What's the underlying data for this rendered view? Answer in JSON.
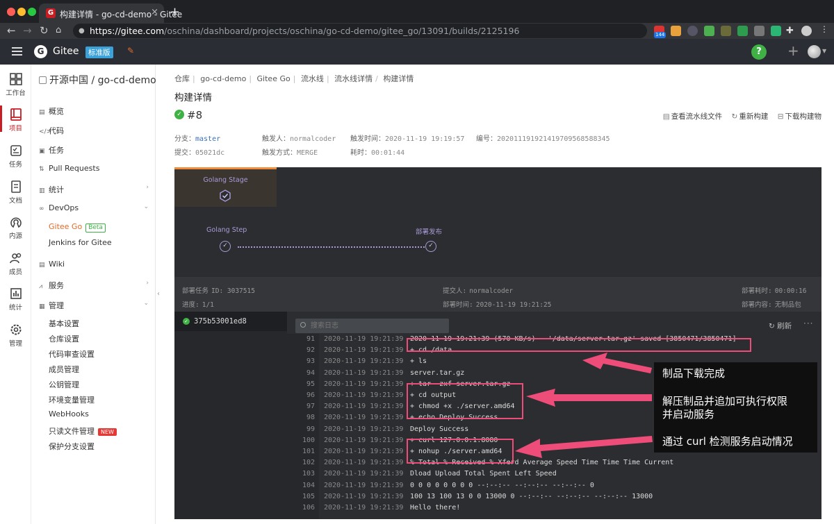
{
  "browser": {
    "tab_title": "构建详情 - go-cd-demo - Gitee",
    "tab_favicon": "G",
    "url_host": "https://gitee.com",
    "url_path": "/oschina/dashboard/projects/oschina/go-cd-demo/gitee_go/13091/builds/2125196",
    "ext_badge": "144"
  },
  "appbar": {
    "brand": "Gitee",
    "edition": "标准版",
    "help": "?"
  },
  "rail": [
    {
      "icon": "dashboard-icon",
      "label": "工作台"
    },
    {
      "icon": "book-icon",
      "label": "项目"
    },
    {
      "icon": "tasks-icon",
      "label": "任务"
    },
    {
      "icon": "document-icon",
      "label": "文档"
    },
    {
      "icon": "opensource-icon",
      "label": "内源"
    },
    {
      "icon": "members-icon",
      "label": "成员"
    },
    {
      "icon": "stats-icon",
      "label": "统计"
    },
    {
      "icon": "settings-icon",
      "label": "管理"
    }
  ],
  "sidebar": {
    "project": "开源中国 / go-cd-demo",
    "items": [
      "概览",
      "代码",
      "任务",
      "Pull Requests",
      "统计",
      "DevOps",
      "Gitee Go",
      "Jenkins for Gitee",
      "Wiki",
      "服务",
      "管理",
      "基本设置",
      "仓库设置",
      "代码审查设置",
      "成员管理",
      "公钥管理",
      "环境变量管理",
      "WebHooks",
      "只读文件管理",
      "保护分支设置"
    ],
    "beta": "Beta",
    "new": "NEW"
  },
  "main": {
    "breadcrumb": [
      "仓库",
      "go-cd-demo",
      "Gitee Go",
      "流水线",
      "流水线详情",
      "构建详情"
    ],
    "title": "构建详情",
    "build_no": "#8",
    "actions": [
      "查看流水线文件",
      "重新构建",
      "下载构建物"
    ],
    "meta": {
      "branch_label": "分支：",
      "branch": "master",
      "trigger_label": "触发人：",
      "trigger": "normalcoder",
      "time_label": "触发时间：",
      "time": "2020-11-19 19:19:57",
      "id_label": "编号：",
      "id": "20201119192141970956858834​5",
      "commit_label": "提交：",
      "commit": "05021dc",
      "mode_label": "触发方式：",
      "mode": "MERGE",
      "dur_label": "耗时：",
      "dur": "00:01:44"
    }
  },
  "pipeline": {
    "stage": "Golang Stage",
    "steps": [
      "Golang Step",
      "部署发布"
    ],
    "info": {
      "task_label": "部署任务",
      "task_id": "ID: 3037515",
      "progress_label": "进度:",
      "progress": "1/1",
      "submitter_label": "提交人:",
      "submitter": "normalcoder",
      "deploy_time_label": "部署时间:",
      "deploy_time": "2020-11-19 19:21:25",
      "deploy_dur_label": "部署耗时:",
      "deploy_dur": "00:00:16",
      "deploy_content_label": "部署内容:",
      "deploy_content": "无制品包"
    },
    "job": "375b53001ed8",
    "search_placeholder": "搜索日志",
    "refresh": "刷新",
    "more": "···"
  },
  "log": [
    {
      "n": "91",
      "t": "2020-11-19 19:21:39",
      "x": "2020-11-19 19:21:39 (570 KB/s) - '/data/server.tar.gz' saved [3850471/3850471]"
    },
    {
      "n": "92",
      "t": "2020-11-19 19:21:39",
      "x": "+ cd /data"
    },
    {
      "n": "93",
      "t": "2020-11-19 19:21:39",
      "x": "+ ls"
    },
    {
      "n": "94",
      "t": "2020-11-19 19:21:39",
      "x": "server.tar.gz"
    },
    {
      "n": "95",
      "t": "2020-11-19 19:21:39",
      "x": "+ tar -zxf server.tar.gz"
    },
    {
      "n": "96",
      "t": "2020-11-19 19:21:39",
      "x": "+ cd output"
    },
    {
      "n": "97",
      "t": "2020-11-19 19:21:39",
      "x": "+ chmod +x ./server.amd64"
    },
    {
      "n": "98",
      "t": "2020-11-19 19:21:39",
      "x": "+ echo Deploy Success"
    },
    {
      "n": "99",
      "t": "2020-11-19 19:21:39",
      "x": "Deploy Success"
    },
    {
      "n": "100",
      "t": "2020-11-19 19:21:39",
      "x": "+ curl 127.0.0.1:8080"
    },
    {
      "n": "101",
      "t": "2020-11-19 19:21:39",
      "x": "+ nohup ./server.amd64"
    },
    {
      "n": "102",
      "t": "2020-11-19 19:21:39",
      "x": "% Total % Received % Xferd Average Speed Time Time Time Current"
    },
    {
      "n": "103",
      "t": "2020-11-19 19:21:39",
      "x": "Dload Upload Total Spent Left Speed"
    },
    {
      "n": "104",
      "t": "2020-11-19 19:21:39",
      "x": "0 0 0 0 0 0 0 0 --:--:-- --:--:-- --:--:-- 0"
    },
    {
      "n": "105",
      "t": "2020-11-19 19:21:39",
      "x": "100 13 100 13 0 0 13000 0 --:--:-- --:--:-- --:--:-- 13000"
    },
    {
      "n": "106",
      "t": "2020-11-19 19:21:39",
      "x": "Hello there!"
    }
  ],
  "annotations": [
    "制品下载完成",
    "解压制品并追加可执行权限",
    "并启动服务",
    "通过 curl 检测服务启动情况"
  ],
  "colors": {
    "accent": "#c71d23",
    "success": "#3fb145",
    "devops": "#e06b2b",
    "highlight": "#ee4d7a",
    "step": "#a99bd8"
  }
}
